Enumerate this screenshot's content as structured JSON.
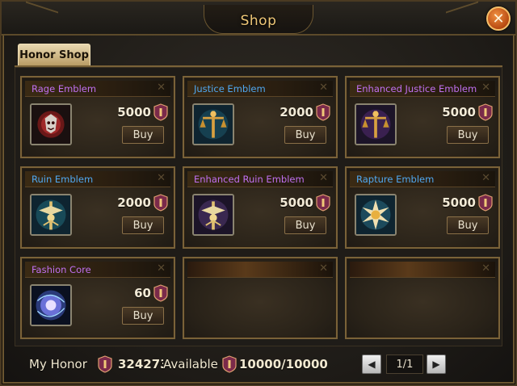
{
  "window": {
    "title": "Shop",
    "close_symbol": "✕"
  },
  "tabs": [
    {
      "label": "Honor Shop",
      "active": true
    }
  ],
  "items": [
    {
      "name": "Rage Emblem",
      "name_color": "#c070f0",
      "price": "5000",
      "buy_label": "Buy",
      "icon": "rage-emblem-icon"
    },
    {
      "name": "Justice Emblem",
      "name_color": "#50a8f0",
      "price": "2000",
      "buy_label": "Buy",
      "icon": "justice-emblem-icon"
    },
    {
      "name": "Enhanced Justice Emblem",
      "name_color": "#c070f0",
      "price": "5000",
      "buy_label": "Buy",
      "icon": "enhanced-justice-emblem-icon"
    },
    {
      "name": "Ruin Emblem",
      "name_color": "#50a8f0",
      "price": "2000",
      "buy_label": "Buy",
      "icon": "ruin-emblem-icon"
    },
    {
      "name": "Enhanced Ruin Emblem",
      "name_color": "#c070f0",
      "price": "5000",
      "buy_label": "Buy",
      "icon": "enhanced-ruin-emblem-icon"
    },
    {
      "name": "Rapture Emblem",
      "name_color": "#50a8f0",
      "price": "5000",
      "buy_label": "Buy",
      "icon": "rapture-emblem-icon"
    },
    {
      "name": "Fashion Core",
      "name_color": "#c070f0",
      "price": "60",
      "buy_label": "Buy",
      "icon": "fashion-core-icon"
    }
  ],
  "footer": {
    "my_honor_label": "My Honor",
    "my_honor_value": "324273",
    "available_label": "Available",
    "available_value": "10000/10000",
    "page": "1/1",
    "prev_symbol": "◀",
    "next_symbol": "▶"
  },
  "colors": {
    "accent": "#f0c878",
    "frame": "#7a6238",
    "close_button": "#d8641e"
  }
}
